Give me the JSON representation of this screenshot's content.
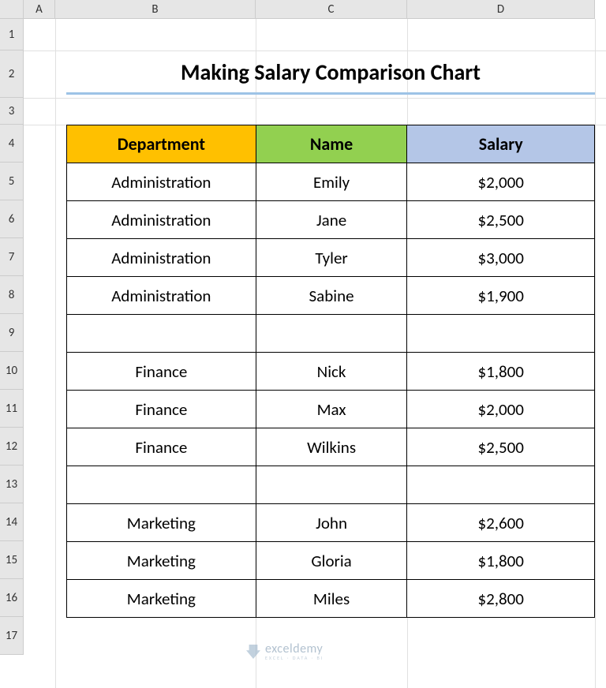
{
  "columns": {
    "corner": "",
    "a": "A",
    "b": "B",
    "c": "C",
    "d": "D"
  },
  "rows": {
    "r1": "1",
    "r2": "2",
    "r3": "3",
    "r4": "4",
    "r5": "5",
    "r6": "6",
    "r7": "7",
    "r8": "8",
    "r9": "9",
    "r10": "10",
    "r11": "11",
    "r12": "12",
    "r13": "13",
    "r14": "14",
    "r15": "15",
    "r16": "16",
    "r17": "17"
  },
  "title": "Making Salary Comparison Chart",
  "headers": {
    "department": "Department",
    "name": "Name",
    "salary": "Salary"
  },
  "table": [
    {
      "department": "Administration",
      "name": "Emily",
      "salary": "$2,000"
    },
    {
      "department": "Administration",
      "name": "Jane",
      "salary": "$2,500"
    },
    {
      "department": "Administration",
      "name": "Tyler",
      "salary": "$3,000"
    },
    {
      "department": "Administration",
      "name": "Sabine",
      "salary": "$1,900"
    },
    {
      "department": "",
      "name": "",
      "salary": ""
    },
    {
      "department": "Finance",
      "name": "Nick",
      "salary": "$1,800"
    },
    {
      "department": "Finance",
      "name": "Max",
      "salary": "$2,000"
    },
    {
      "department": "Finance",
      "name": "Wilkins",
      "salary": "$2,500"
    },
    {
      "department": "",
      "name": "",
      "salary": ""
    },
    {
      "department": "Marketing",
      "name": "John",
      "salary": "$2,600"
    },
    {
      "department": "Marketing",
      "name": "Gloria",
      "salary": "$1,800"
    },
    {
      "department": "Marketing",
      "name": "Miles",
      "salary": "$2,800"
    }
  ],
  "watermark": {
    "main": "exceldemy",
    "sub": "EXCEL · DATA · BI"
  }
}
